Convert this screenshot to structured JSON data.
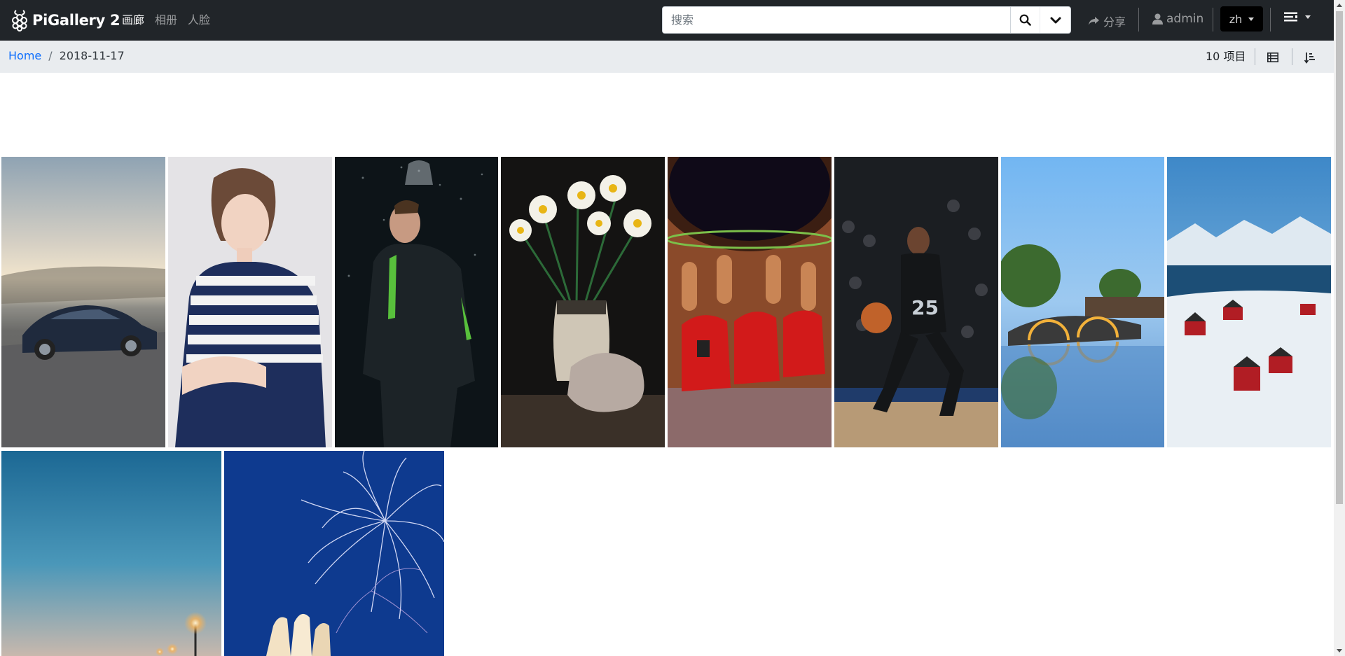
{
  "app": {
    "brand": "PiGallery 2",
    "nav": [
      "画廊",
      "相册",
      "人脸"
    ],
    "search_placeholder": "搜索",
    "share_label": "分享",
    "user_label": "admin",
    "language": "zh"
  },
  "breadcrumb": {
    "home": "Home",
    "separator": "/",
    "current": "2018-11-17"
  },
  "toolbar": {
    "item_count": "10 项目"
  },
  "colors": {
    "navbar": "#212529",
    "crumbbar": "#e9ecef",
    "link": "#0d6efd"
  },
  "icons": {
    "logo": "raspberry-icon",
    "search": "search-icon",
    "search_options": "chevron-down-icon",
    "share": "share-icon",
    "user": "user-icon",
    "menu": "menu-icon",
    "view": "list-view-icon",
    "sort": "sort-icon"
  },
  "photos": [
    {
      "subject": "car-on-road"
    },
    {
      "subject": "woman-striped-sweater"
    },
    {
      "subject": "man-in-rain-jacket"
    },
    {
      "subject": "daffodils-in-jug"
    },
    {
      "subject": "home-theater-red-seats"
    },
    {
      "subject": "basketball-player"
    },
    {
      "subject": "bridge-reflection"
    },
    {
      "subject": "snowy-village-fjord"
    },
    {
      "subject": "harbor-lamps-dusk"
    },
    {
      "subject": "fireworks-over-building"
    }
  ]
}
